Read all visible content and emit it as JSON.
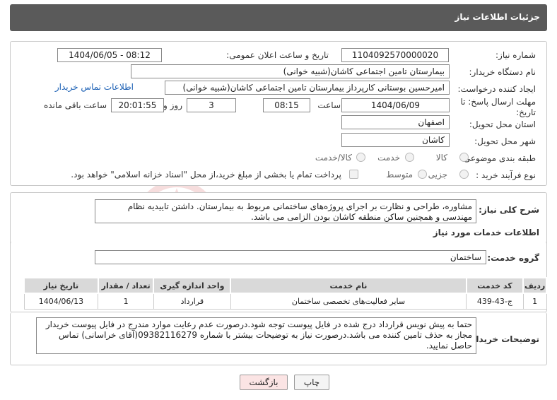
{
  "header": {
    "title": "جزئیات اطلاعات نیاز"
  },
  "fields": {
    "need_number_label": "شماره نیاز:",
    "need_number": "1104092570000020",
    "announce_label": "تاریخ و ساعت اعلان عمومی:",
    "announce_value": "1404/06/05 - 08:12",
    "buyer_org_label": "نام دستگاه خریدار:",
    "buyer_org": "بیمارستان تامین اجتماعی کاشان(شبیه خوانی)",
    "creator_label": "ایجاد کننده درخواست:",
    "creator": "امیرحسین بوستانی کارپرداز بیمارستان تامین اجتماعی کاشان(شبیه خوانی)",
    "contact_link": "اطلاعات تماس خریدار",
    "deadline_label": "مهلت ارسال پاسخ: تا تاریخ:",
    "deadline_date": "1404/06/09",
    "time_label": "ساعت",
    "deadline_time": "08:15",
    "days_value": "3",
    "days_label": "روز و",
    "remaining_time": "20:01:55",
    "remaining_label": "ساعت باقی مانده",
    "province_label": "استان محل تحویل:",
    "province": "اصفهان",
    "city_label": "شهر محل تحویل:",
    "city": "کاشان",
    "category_label": "طبقه بندی موضوعی:",
    "category_options": [
      "کالا",
      "خدمت",
      "کالا/خدمت"
    ],
    "process_label": "نوع فرآیند خرید :",
    "process_options": [
      "جزیی",
      "متوسط"
    ],
    "payment_note": "پرداخت تمام یا بخشی از مبلغ خرید،از محل \"اسناد خزانه اسلامی\" خواهد بود."
  },
  "summary": {
    "label": "شرح کلی نیاز:",
    "text": "مشاوره، طراحی و نظارت بر اجرای پروژه‌های ساختمانی مربوط به بیمارستان. داشتن تاییدیه نظام مهندسی و همچنین ساکن منطقه کاشان بودن الزامی می باشد."
  },
  "services": {
    "section_title": "اطلاعات خدمات مورد نیاز",
    "group_label": "گروه خدمت:",
    "group_value": "ساختمان",
    "columns": [
      "ردیف",
      "کد خدمت",
      "نام خدمت",
      "واحد اندازه گیری",
      "تعداد / مقدار",
      "تاریخ نیاز"
    ],
    "rows": [
      [
        "1",
        "ج-43-439",
        "سایر فعالیت‌های تخصصی ساختمان",
        "قرارداد",
        "1",
        "1404/06/13"
      ]
    ]
  },
  "buyer_notes": {
    "label": "توضیحات خریدار:",
    "text": "حتما به پیش نویس قرارداد درج شده در فایل پیوست توجه شود.درصورت عدم رعایت موارد مندرج در فایل پیوست خریدار مجاز به حذف تامین کننده می باشد.درصورت نیاز به توضیحات بیشتر با شماره 09382116279(آقای خراسانی) تماس حاصل نمایید."
  },
  "buttons": {
    "print": "چاپ",
    "back": "بازگشت"
  },
  "watermark": {
    "text": "AriaTender.neT"
  },
  "colors": {
    "header_bg": "#5a5a5a",
    "link": "#1a5fb4",
    "back_button_bg": "#fbe4e4",
    "watermark": "#c00000"
  }
}
